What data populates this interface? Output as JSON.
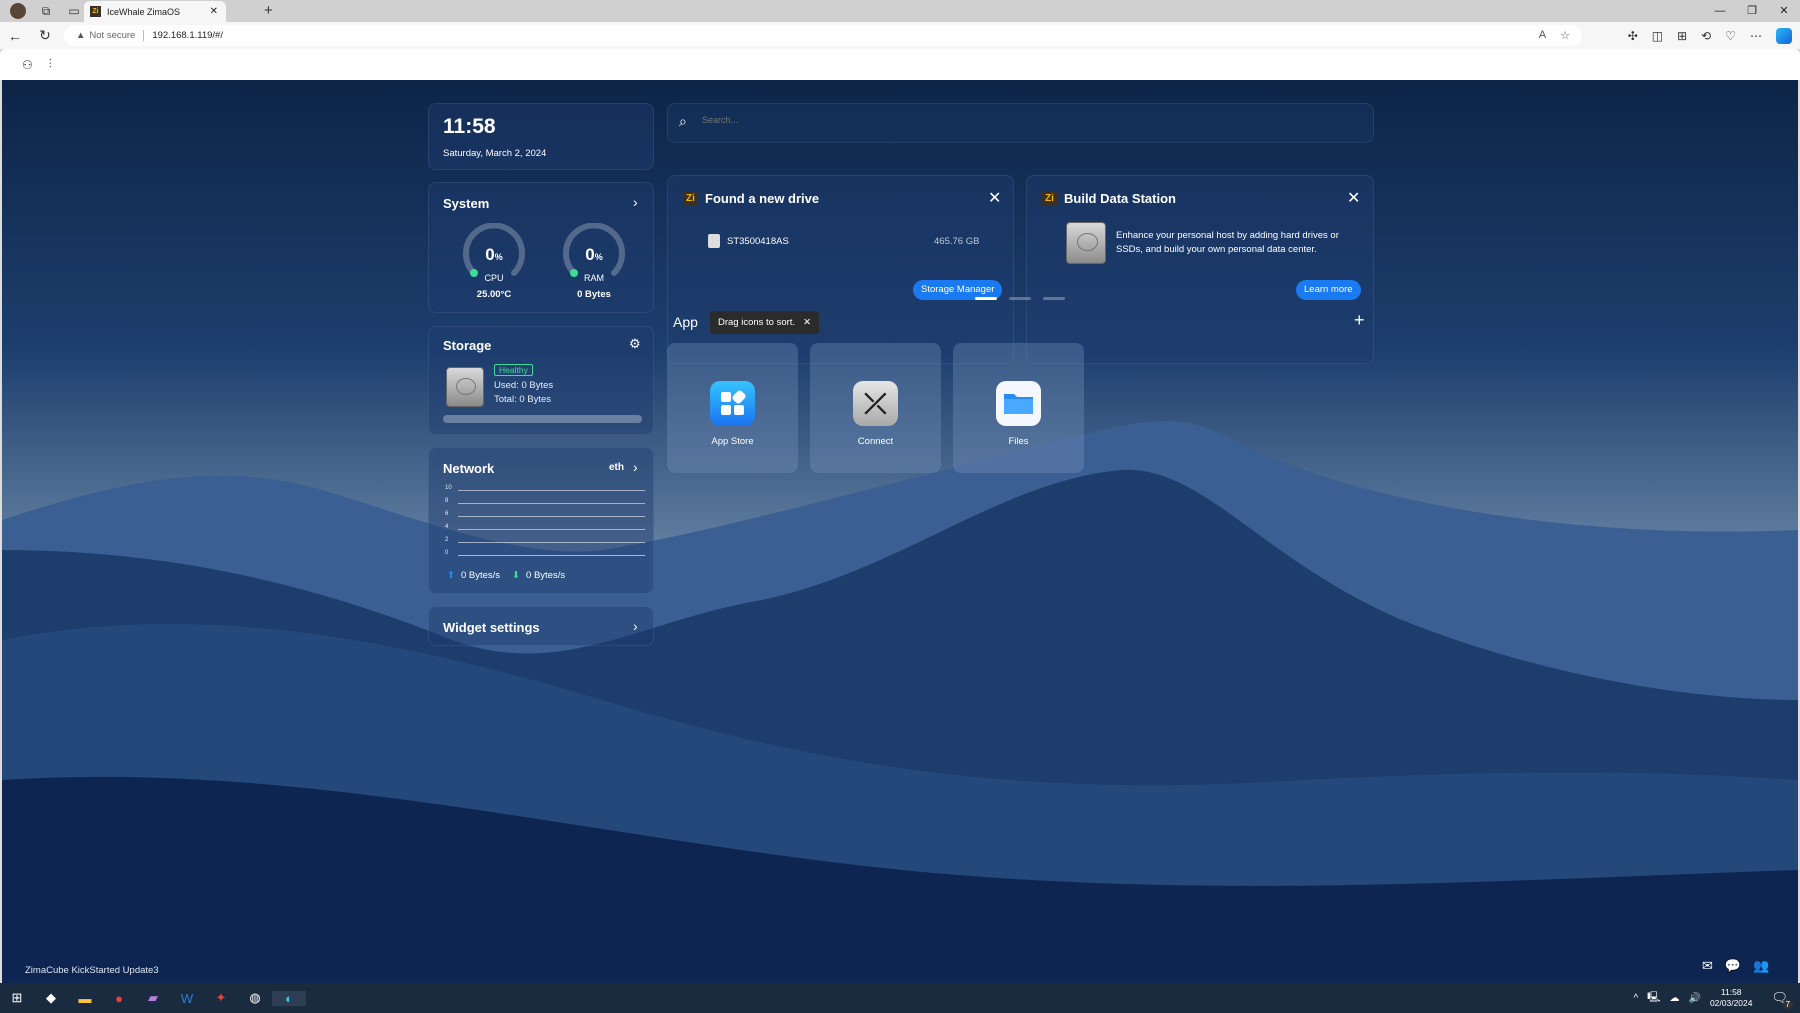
{
  "browser": {
    "tab_title": "IceWhale ZimaOS",
    "tab_favicon": "Zi",
    "security_label": "Not secure",
    "url": "192.168.1.119/#/"
  },
  "widgets": {
    "clock": {
      "time": "11:58",
      "date": "Saturday, March 2, 2024"
    },
    "system": {
      "title": "System",
      "cpu": {
        "value": "0",
        "unit": "%",
        "label": "CPU",
        "sub": "25.00°C",
        "percent": 0
      },
      "ram": {
        "value": "0",
        "unit": "%",
        "label": "RAM",
        "sub": "0 Bytes",
        "percent": 0
      }
    },
    "storage": {
      "title": "Storage",
      "status": "Healthy",
      "used": "Used: 0 Bytes",
      "total": "Total: 0 Bytes",
      "percent": 0
    },
    "network": {
      "title": "Network",
      "interface": "eth",
      "ticks": [
        "10",
        "8",
        "6",
        "4",
        "2",
        "0"
      ],
      "upload": "0 Bytes/s",
      "download": "0 Bytes/s"
    },
    "widget_settings": {
      "title": "Widget settings"
    }
  },
  "search": {
    "placeholder": "Search..."
  },
  "notices": [
    {
      "icon": "Zi",
      "title": "Found a new drive",
      "drive_name": "ST3500418AS",
      "drive_size": "465.76 GB",
      "button": "Storage Manager"
    },
    {
      "icon": "Zi",
      "title": "Build Data Station",
      "text": "Enhance your personal host by adding hard drives or SSDs, and build your own personal data center.",
      "button": "Learn more"
    }
  ],
  "apps": {
    "title": "App",
    "tooltip": "Drag icons to sort.",
    "items": [
      {
        "label": "App Store"
      },
      {
        "label": "Connect"
      },
      {
        "label": "Files"
      }
    ]
  },
  "footer": {
    "version": "ZimaCube KickStarted Update3"
  },
  "taskbar": {
    "time": "11:58",
    "date": "02/03/2024",
    "notifications": "7"
  },
  "colors": {
    "accent": "#1a7af2",
    "healthy": "#3ddc97"
  }
}
